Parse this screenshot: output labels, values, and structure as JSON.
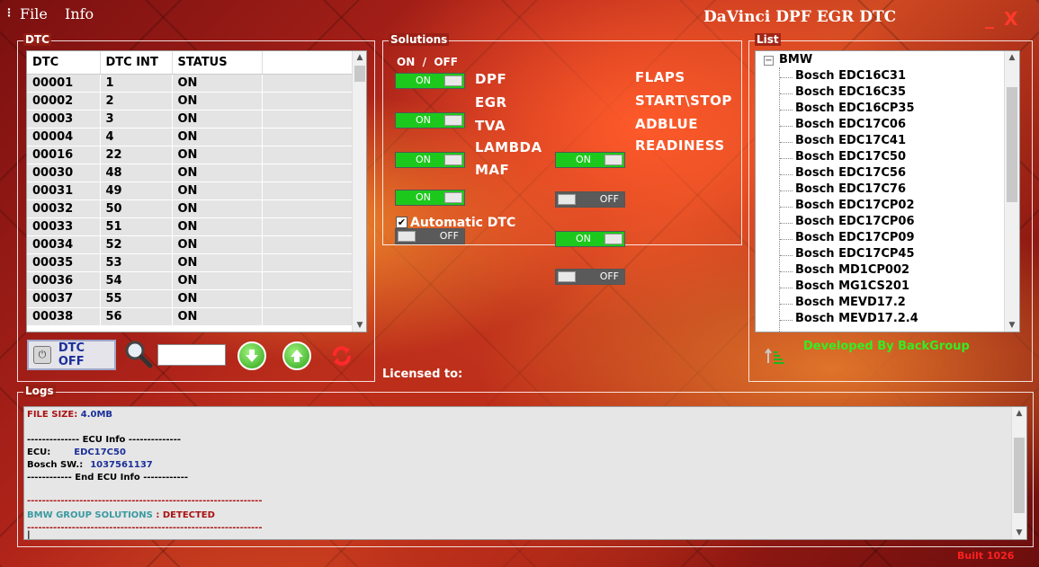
{
  "menu": {
    "file": "File",
    "info": "Info"
  },
  "window": {
    "title": "DaVinci DPF EGR DTC",
    "minimize_glyph": "_",
    "close_glyph": "X"
  },
  "dtc": {
    "group_label": "DTC",
    "columns": [
      "DTC",
      "DTC INT",
      "STATUS",
      ""
    ],
    "rows": [
      [
        "00001",
        "1",
        "ON"
      ],
      [
        "00002",
        "2",
        "ON"
      ],
      [
        "00003",
        "3",
        "ON"
      ],
      [
        "00004",
        "4",
        "ON"
      ],
      [
        "00016",
        "22",
        "ON"
      ],
      [
        "00030",
        "48",
        "ON"
      ],
      [
        "00031",
        "49",
        "ON"
      ],
      [
        "00032",
        "50",
        "ON"
      ],
      [
        "00033",
        "51",
        "ON"
      ],
      [
        "00034",
        "52",
        "ON"
      ],
      [
        "00035",
        "53",
        "ON"
      ],
      [
        "00036",
        "54",
        "ON"
      ],
      [
        "00037",
        "55",
        "ON"
      ],
      [
        "00038",
        "56",
        "ON"
      ]
    ],
    "off_button": "DTC OFF",
    "search_value": ""
  },
  "solutions": {
    "group_label": "Solutions",
    "header": "ON  /  OFF",
    "on_text": "ON",
    "off_text": "OFF",
    "left": [
      {
        "label": "DPF",
        "state": "ON"
      },
      {
        "label": "EGR",
        "state": "ON"
      },
      {
        "label": "TVA",
        "state": "ON"
      },
      {
        "label": "LAMBDA",
        "state": "ON"
      },
      {
        "label": "MAF",
        "state": "OFF"
      }
    ],
    "right": [
      {
        "label": "FLAPS",
        "state": "ON"
      },
      {
        "label": "START\\STOP",
        "state": "OFF"
      },
      {
        "label": "ADBLUE",
        "state": "ON"
      },
      {
        "label": "READINESS",
        "state": "OFF"
      }
    ],
    "automatic_dtc": "Automatic DTC",
    "automatic_checked": true
  },
  "licensed_to": "Licensed to:",
  "list": {
    "group_label": "List",
    "root": "BMW",
    "expander": "−",
    "items": [
      "Bosch EDC16C31",
      "Bosch EDC16C35",
      "Bosch EDC16CP35",
      "Bosch EDC17C06",
      "Bosch EDC17C41",
      "Bosch EDC17C50",
      "Bosch EDC17C56",
      "Bosch EDC17C76",
      "Bosch EDC17CP02",
      "Bosch EDC17CP06",
      "Bosch EDC17CP09",
      "Bosch EDC17CP45",
      "Bosch MD1CP002",
      "Bosch MG1CS201",
      "Bosch MEVD17.2",
      "Bosch MEVD17.2.4"
    ]
  },
  "developed_by": "Developed By BackGroup",
  "logs": {
    "group_label": "Logs",
    "file_size_label": "FILE SIZE: ",
    "file_size_value": "4.0MB",
    "ecu_info_start": "-------------- ECU Info --------------",
    "ecu_label": "ECU:",
    "ecu_value": "EDC17C50",
    "bosch_label": "Bosch SW.:",
    "bosch_value": "1037561137",
    "ecu_info_end": "------------ End ECU Info ------------",
    "separator": "---------------------------------------------------------------",
    "solutions_label": "BMW GROUP SOLUTIONS",
    "solutions_sep": " : ",
    "solutions_value": "DETECTED",
    "cursor": "|"
  },
  "build": "Built 1026",
  "colors": {
    "toggle_on": "#1dc81d",
    "toggle_off": "#5a5a5a",
    "developed_by": "#33ee22",
    "log_red": "#aa1111",
    "log_blue": "#1b2f99",
    "log_teal": "#3a9aa0",
    "build": "#ff2020"
  },
  "icons": [
    "power-icon",
    "magnifier-icon",
    "arrow-down-icon",
    "arrow-up-icon",
    "refresh-icon",
    "sort-icon",
    "checkbox-icon"
  ]
}
